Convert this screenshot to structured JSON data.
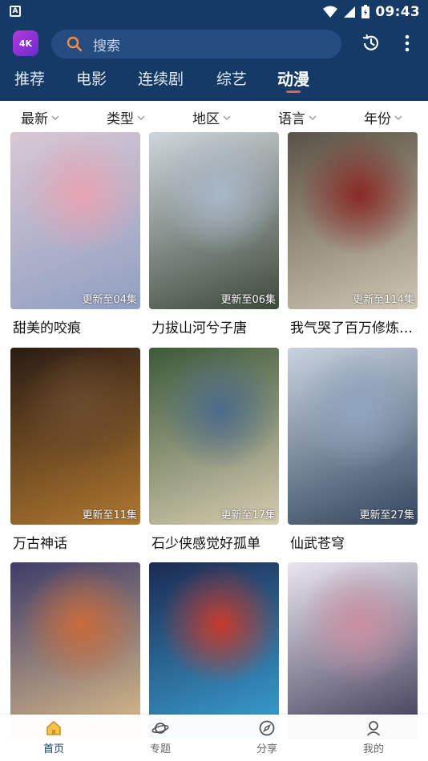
{
  "status_bar": {
    "time": "09:43"
  },
  "header": {
    "logo_text": "4K",
    "search_placeholder": "搜索"
  },
  "tabs": [
    {
      "label": "推荐",
      "active": false
    },
    {
      "label": "电影",
      "active": false
    },
    {
      "label": "连续剧",
      "active": false
    },
    {
      "label": "综艺",
      "active": false
    },
    {
      "label": "动漫",
      "active": true
    }
  ],
  "filters": [
    "最新",
    "类型",
    "地区",
    "语言",
    "年份"
  ],
  "cards": [
    {
      "title": "甜美的咬痕",
      "badge": "更新至04集",
      "palette": [
        "#d9c7d3",
        "#8fa0c2",
        "#e7a2b1"
      ]
    },
    {
      "title": "力拔山河兮子唐",
      "badge": "更新至06集",
      "palette": [
        "#cfd6dc",
        "#3d4a3b",
        "#a8b7c8"
      ]
    },
    {
      "title": "我气哭了百万修炼…",
      "badge": "更新至114集",
      "palette": [
        "#5a5245",
        "#cfc6b3",
        "#8a2a24"
      ]
    },
    {
      "title": "万古神话",
      "badge": "更新至11集",
      "palette": [
        "#2a1c14",
        "#b0782f",
        "#6b4b2d"
      ]
    },
    {
      "title": "石少侠感觉好孤单",
      "badge": "更新至17集",
      "palette": [
        "#3d5a3a",
        "#d6cbb0",
        "#4b6b8b"
      ]
    },
    {
      "title": "仙武苍穹",
      "badge": "更新至27集",
      "palette": [
        "#c9d3df",
        "#33465e",
        "#8ea3bd"
      ]
    },
    {
      "title": "",
      "badge": "",
      "palette": [
        "#3e3c6a",
        "#e0c08a",
        "#c96b3a"
      ]
    },
    {
      "title": "",
      "badge": "",
      "palette": [
        "#1c2a52",
        "#3aa6d8",
        "#c83a2a"
      ]
    },
    {
      "title": "",
      "badge": "",
      "palette": [
        "#e9e6ef",
        "#3a3552",
        "#c98fa0"
      ]
    }
  ],
  "bottom_nav": [
    {
      "label": "首页",
      "icon": "home-icon",
      "active": true
    },
    {
      "label": "专题",
      "icon": "planet-icon",
      "active": false
    },
    {
      "label": "分享",
      "icon": "share-compass-icon",
      "active": false
    },
    {
      "label": "我的",
      "icon": "user-icon",
      "active": false
    }
  ],
  "colors": {
    "header_bg": "#163a66",
    "search_bg": "#244c80",
    "accent": "#ff5a3d"
  }
}
